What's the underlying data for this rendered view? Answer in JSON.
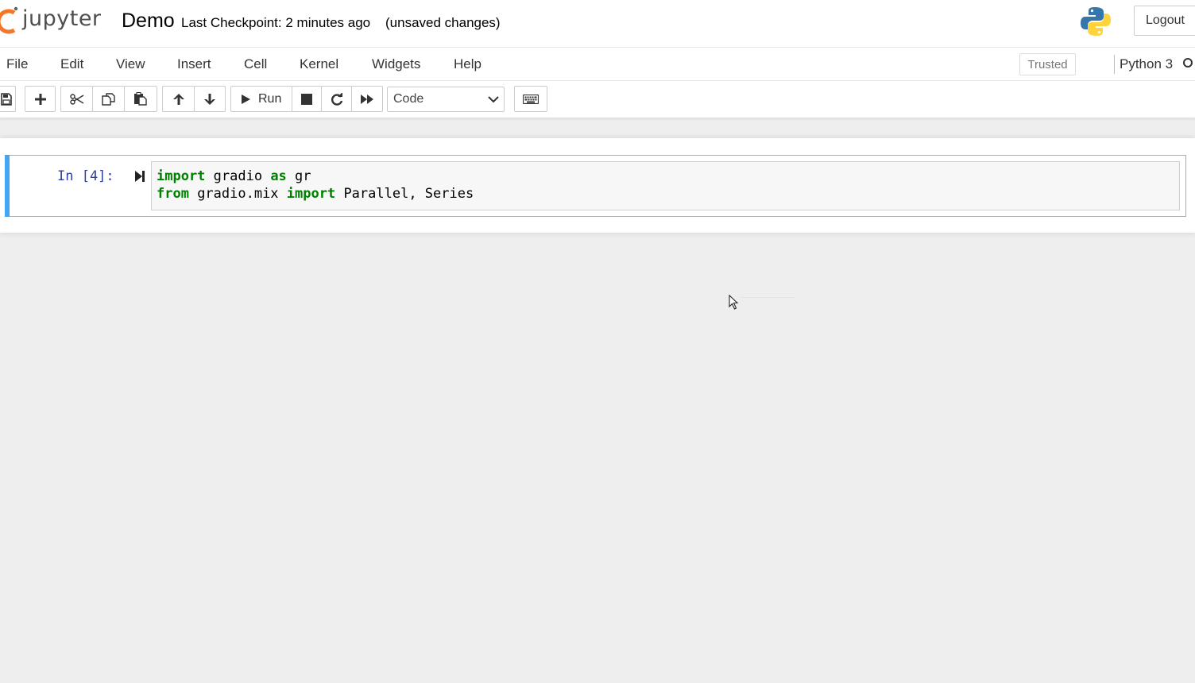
{
  "header": {
    "logo_text": "jupyter",
    "notebook_title": "Demo",
    "checkpoint": "Last Checkpoint: 2 minutes ago",
    "autosave_status": "(unsaved changes)",
    "logout_label": "Logout"
  },
  "menubar": {
    "items": [
      "File",
      "Edit",
      "View",
      "Insert",
      "Cell",
      "Kernel",
      "Widgets",
      "Help"
    ],
    "trusted_label": "Trusted",
    "kernel_name": "Python 3"
  },
  "toolbar": {
    "run_label": "Run",
    "cell_type": "Code",
    "icons": [
      "save-icon",
      "plus-icon",
      "cut-icon",
      "copy-icon",
      "paste-icon",
      "arrow-up-icon",
      "arrow-down-icon",
      "play-icon",
      "stop-icon",
      "restart-icon",
      "fast-forward-icon",
      "chevron-down-icon",
      "keyboard-icon"
    ]
  },
  "cell": {
    "prompt": "In [4]:",
    "lines": [
      {
        "kw1": "import",
        "t1": " gradio ",
        "kw2": "as",
        "t2": " gr"
      },
      {
        "kw1": "from",
        "t1": " gradio.mix ",
        "kw2": "import",
        "t2": " Parallel, Series"
      }
    ]
  },
  "colors": {
    "accent": "#42a5f5",
    "keyword": "#008000",
    "prompt": "#303f9f",
    "logo_orange": "#f37726"
  }
}
